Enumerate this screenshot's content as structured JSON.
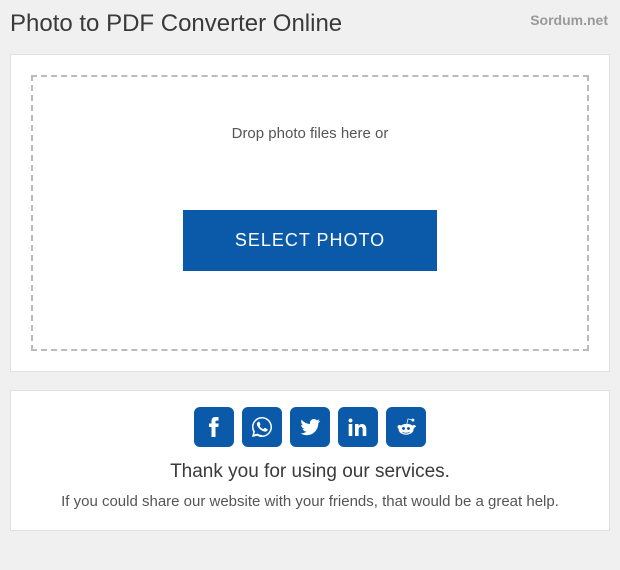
{
  "header": {
    "title": "Photo to PDF Converter Online",
    "brand": "Sordum.net"
  },
  "dropzone": {
    "text": "Drop photo files here or",
    "button_label": "SELECT PHOTO"
  },
  "share": {
    "thank_text": "Thank you for using our services.",
    "help_text": "If you could share our website with your friends, that would be a great help.",
    "icons": {
      "facebook": "facebook",
      "whatsapp": "whatsapp",
      "twitter": "twitter",
      "linkedin": "linkedin",
      "reddit": "reddit"
    }
  }
}
